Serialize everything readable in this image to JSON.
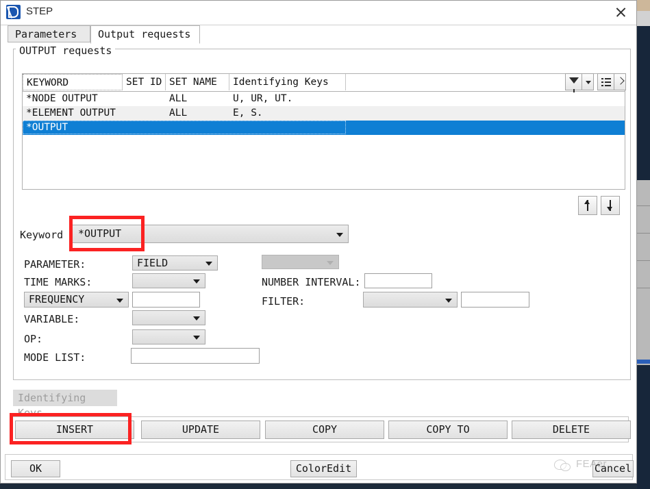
{
  "window": {
    "title": "STEP",
    "app_icon": "abaqus-d-icon",
    "close_label": "×"
  },
  "tabs": [
    {
      "label": "Parameters",
      "active": false
    },
    {
      "label": "Output requests",
      "active": true
    }
  ],
  "group": {
    "title": "OUTPUT requests"
  },
  "grid_toolbar": {
    "filter_icon": "filter-funnel-icon",
    "filter_dropdown_icon": "chevron-down-icon",
    "columns_icon": "column-list-icon",
    "next_icon": "chevron-right-icon"
  },
  "grid": {
    "columns": [
      "KEYWORD",
      "SET ID",
      "SET NAME",
      "Identifying Keys"
    ],
    "rows": [
      {
        "keyword": "*NODE OUTPUT",
        "set_id": "",
        "set_name": "ALL",
        "keys": "U, UR, UT.",
        "selected": false,
        "alt": false
      },
      {
        "keyword": "*ELEMENT OUTPUT",
        "set_id": "",
        "set_name": "ALL",
        "keys": "E, S.",
        "selected": false,
        "alt": true
      },
      {
        "keyword": "*OUTPUT",
        "set_id": "",
        "set_name": "",
        "keys": "",
        "selected": true,
        "alt": false
      }
    ]
  },
  "move_buttons": {
    "up_icon": "arrow-up-icon",
    "down_icon": "arrow-down-icon"
  },
  "form": {
    "keyword_label": "Keyword",
    "keyword_value": "*OUTPUT",
    "parameter_label": "PARAMETER:",
    "parameter_value": "FIELD",
    "extra_value": "",
    "time_marks_label": "TIME MARKS:",
    "time_marks_value": "",
    "frequency_label": "FREQUENCY",
    "frequency_value": "",
    "variable_label": "VARIABLE:",
    "variable_value": "",
    "op_label": "OP:",
    "op_value": "",
    "mode_list_label": "MODE LIST:",
    "mode_list_value": "",
    "number_interval_label": "NUMBER INTERVAL:",
    "number_interval_value": "",
    "filter_label": "FILTER:",
    "filter_value": "",
    "filter_text_value": ""
  },
  "identifying_keys_button": "Identifying Keys",
  "actions": [
    "INSERT",
    "UPDATE",
    "COPY",
    "COPY TO",
    "DELETE"
  ],
  "footer": {
    "ok": "OK",
    "coloredit": "ColorEdit",
    "cancel": "Cancel"
  },
  "watermark": {
    "text": "FEAer",
    "icon": "wechat-icon"
  },
  "highlights": {
    "accent_color": "#fb2222",
    "selection_color": "#0f7fd4"
  }
}
